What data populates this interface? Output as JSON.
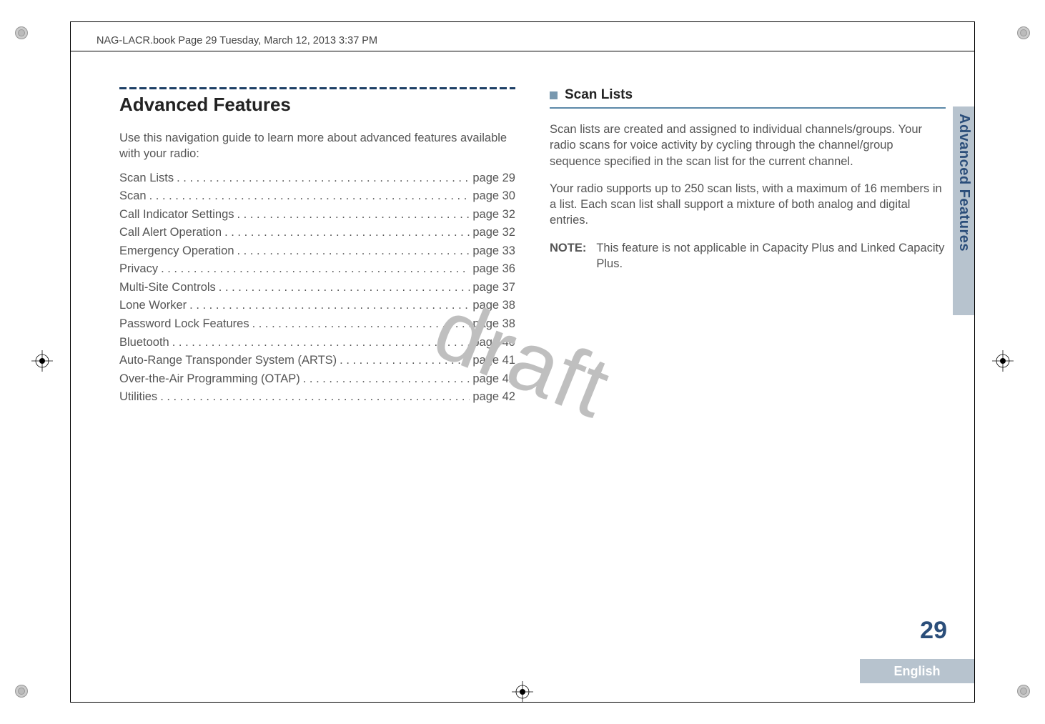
{
  "header": "NAG-LACR.book  Page 29  Tuesday, March 12, 2013  3:37 PM",
  "watermark": "draft",
  "chapter_title": "Advanced Features",
  "intro": "Use this navigation guide to learn more about advanced features available with your radio:",
  "toc": [
    {
      "label": "Scan Lists",
      "page": "page 29"
    },
    {
      "label": "Scan",
      "page": "page 30"
    },
    {
      "label": "Call Indicator Settings",
      "page": "page 32"
    },
    {
      "label": "Call Alert Operation",
      "page": "page 32"
    },
    {
      "label": "Emergency Operation",
      "page": "page 33"
    },
    {
      "label": "Privacy",
      "page": "page 36"
    },
    {
      "label": "Multi-Site Controls",
      "page": "page 37"
    },
    {
      "label": "Lone Worker",
      "page": "page 38"
    },
    {
      "label": "Password Lock Features",
      "page": "page 38"
    },
    {
      "label": "Bluetooth",
      "page": "page 40"
    },
    {
      "label": "Auto-Range Transponder System (ARTS)",
      "page": "page 41"
    },
    {
      "label": "Over-the-Air Programming (OTAP)",
      "page": "page 42"
    },
    {
      "label": "Utilities",
      "page": "page 42"
    }
  ],
  "section": {
    "title": "Scan Lists",
    "p1": "Scan lists are created and assigned to individual channels/groups. Your radio scans for voice activity by cycling through the channel/group sequence specified in the scan list for the current channel.",
    "p2": "Your radio supports up to 250 scan lists, with a maximum of 16 members in a list. Each scan list shall support a mixture of both analog and digital entries.",
    "note_label": "NOTE:",
    "note_body": "This feature is not applicable in Capacity Plus and Linked Capacity Plus."
  },
  "side_tab": "Advanced Features",
  "page_number": "29",
  "language": "English"
}
